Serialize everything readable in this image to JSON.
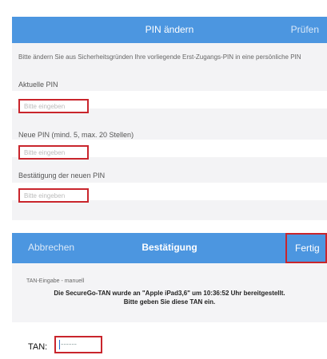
{
  "screen1": {
    "title": "PIN ändern",
    "check_label": "Prüfen",
    "intro": "Bitte ändern Sie aus Sicherheitsgründen Ihre vorliegende Erst-Zugangs-PIN in eine persönliche PIN",
    "current_pin_label": "Aktuelle PIN",
    "new_pin_label": "Neue PIN (mind. 5, max. 20 Stellen)",
    "confirm_pin_label": "Bestätigung der neuen PIN",
    "placeholder": "Bitte eingeben"
  },
  "screen2": {
    "cancel_label": "Abbrechen",
    "title": "Bestätigung",
    "done_label": "Fertig",
    "tan_mode": "TAN-Eingabe - manuell",
    "message_line1": "Die SecureGo-TAN wurde an \"Apple iPad3,6\" um 10:36:52 Uhr bereitgestellt.",
    "message_line2": "Bitte geben Sie diese TAN ein.",
    "tan_label": "TAN:",
    "tan_value": "------"
  },
  "colors": {
    "nav_blue": "#4c96e0",
    "highlight_red": "#c9252c",
    "background_grey": "#f3f3f5"
  }
}
